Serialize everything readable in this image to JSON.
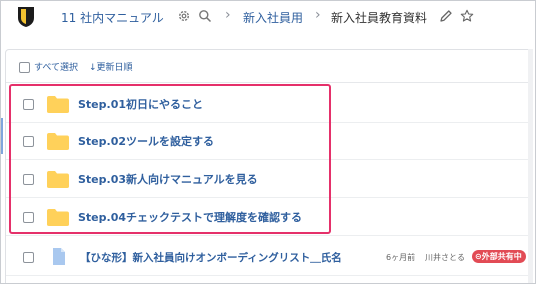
{
  "header": {
    "space_name": "11 社内マニュアル",
    "breadcrumb": [
      {
        "label": "新入社員用"
      },
      {
        "label": "新入社員教育資料"
      }
    ],
    "separator": "›",
    "icons": {
      "logo": "shield-logo",
      "settings": "gear-icon",
      "search": "search-icon",
      "edit": "pencil-icon",
      "favorite": "star-icon"
    }
  },
  "toolbar": {
    "select_all": "すべて選択",
    "sort_label": "↓更新日順"
  },
  "folders": [
    {
      "title": "Step.01初日にやること"
    },
    {
      "title": "Step.02ツールを設定する"
    },
    {
      "title": "Step.03新人向けマニュアルを見る"
    },
    {
      "title": "Step.04チェックテストで理解度を確認する"
    }
  ],
  "documents": [
    {
      "title": "【ひな形】新入社員向けオンボーディングリスト＿氏名",
      "updated": "6ヶ月前",
      "author": "川井さとる",
      "badge": "外部共有中"
    }
  ],
  "colors": {
    "link": "#2f5f9e",
    "folder": "#ffd15a",
    "highlight": "#e5306a",
    "badge": "#e24b55"
  }
}
